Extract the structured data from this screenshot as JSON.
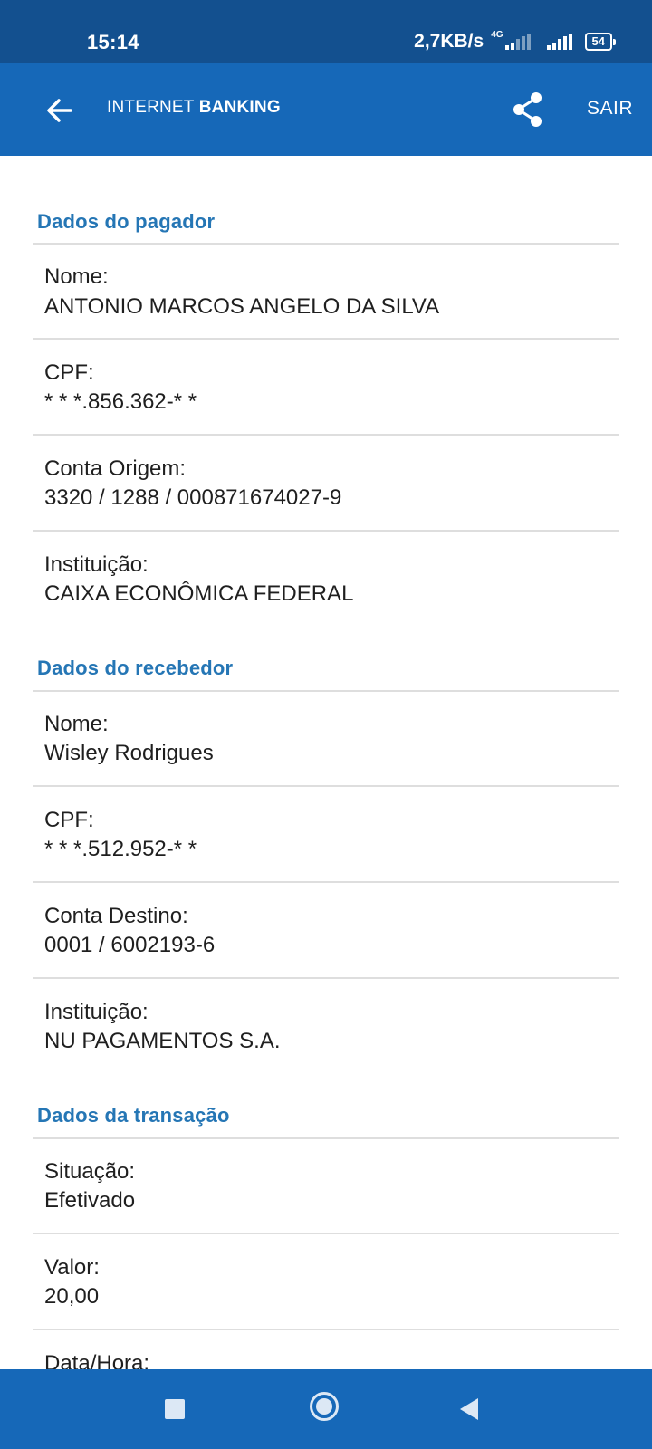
{
  "status_bar": {
    "time": "15:14",
    "speed": "2,7KB/s",
    "network": "4G",
    "battery": "54"
  },
  "header": {
    "title_light": "INTERNET ",
    "title_bold": "BANKING",
    "logout_label": "SAIR"
  },
  "payer": {
    "title": "Dados do pagador",
    "name_label": "Nome:",
    "name_value": "ANTONIO MARCOS ANGELO DA SILVA",
    "cpf_label": "CPF:",
    "cpf_value": "* * *.856.362-* *",
    "account_label": "Conta Origem:",
    "account_value": "3320 / 1288 / 000871674027-9",
    "institution_label": "Instituição:",
    "institution_value": "CAIXA ECONÔMICA FEDERAL"
  },
  "receiver": {
    "title": "Dados do recebedor",
    "name_label": "Nome:",
    "name_value": "Wisley Rodrigues",
    "cpf_label": "CPF:",
    "cpf_value": "* * *.512.952-* *",
    "account_label": "Conta Destino:",
    "account_value": "0001 / 6002193-6",
    "institution_label": "Instituição:",
    "institution_value": "NU PAGAMENTOS S.A."
  },
  "transaction": {
    "title": "Dados da transação",
    "status_label": "Situação:",
    "status_value": "Efetivado",
    "amount_label": "Valor:",
    "amount_value": "20,00",
    "datetime_label": "Data/Hora:"
  },
  "icons": {
    "back": "arrow-left-icon",
    "share": "share-icon",
    "nav_recents": "square-icon",
    "nav_home": "circle-icon",
    "nav_back": "triangle-back-icon"
  },
  "colors": {
    "status_bar": "#13508f",
    "app_bar": "#1668b8",
    "section_title": "#2576b5",
    "divider": "#dedede"
  }
}
